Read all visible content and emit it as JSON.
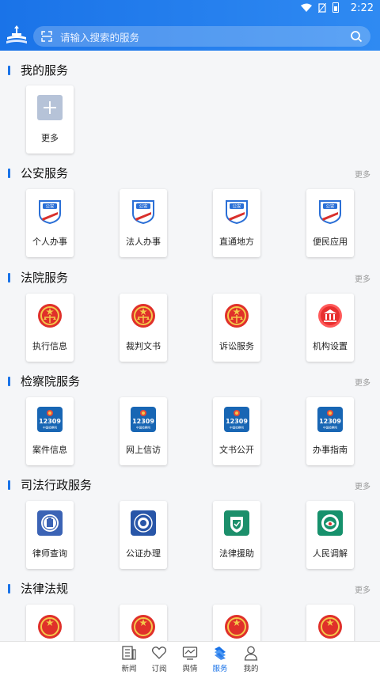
{
  "status_bar": {
    "time": "2:22"
  },
  "search": {
    "placeholder": "请输入搜索的服务"
  },
  "sections": {
    "my": {
      "title": "我的服务",
      "items": [
        {
          "label": "更多"
        }
      ]
    },
    "police": {
      "title": "公安服务",
      "more": "更多",
      "items": [
        {
          "label": "个人办事"
        },
        {
          "label": "法人办事"
        },
        {
          "label": "直通地方"
        },
        {
          "label": "便民应用"
        }
      ]
    },
    "court": {
      "title": "法院服务",
      "more": "更多",
      "items": [
        {
          "label": "执行信息"
        },
        {
          "label": "裁判文书"
        },
        {
          "label": "诉讼服务"
        },
        {
          "label": "机构设置"
        }
      ]
    },
    "procuratorate": {
      "title": "检察院服务",
      "more": "更多",
      "items": [
        {
          "label": "案件信息"
        },
        {
          "label": "网上信访"
        },
        {
          "label": "文书公开"
        },
        {
          "label": "办事指南"
        }
      ]
    },
    "judicial": {
      "title": "司法行政服务",
      "more": "更多",
      "items": [
        {
          "label": "律师查询"
        },
        {
          "label": "公证办理"
        },
        {
          "label": "法律援助"
        },
        {
          "label": "人民调解"
        }
      ]
    },
    "law": {
      "title": "法律法规",
      "more": "更多"
    }
  },
  "icon_text": {
    "police_badge": "公安",
    "hotline": "12309",
    "hotline_sub": "中国检察网"
  },
  "tabs": [
    {
      "label": "新闻",
      "icon": "news-icon"
    },
    {
      "label": "订阅",
      "icon": "heart-icon"
    },
    {
      "label": "舆情",
      "icon": "monitor-icon"
    },
    {
      "label": "服务",
      "icon": "service-icon",
      "active": true
    },
    {
      "label": "我的",
      "icon": "user-icon"
    }
  ],
  "colors": {
    "primary": "#1a73e8",
    "court_red": "#e0302a",
    "police_blue": "#2a6fd6",
    "procuratorate_blue": "#1866b4",
    "judicial_green": "#1c8f6b"
  }
}
